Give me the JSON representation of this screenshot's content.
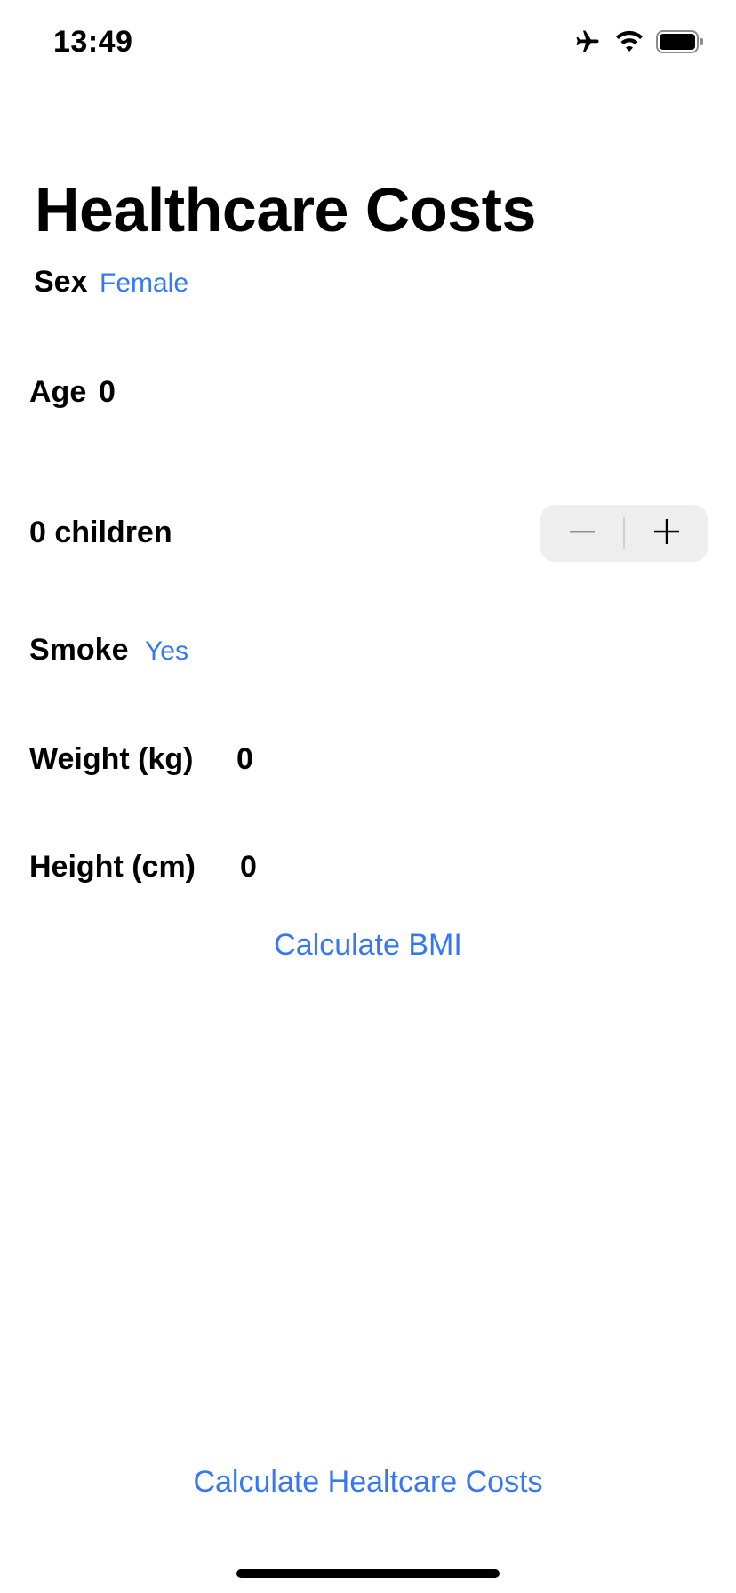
{
  "status_bar": {
    "time": "13:49",
    "icons": [
      "airplane-icon",
      "wifi-icon",
      "battery-icon"
    ]
  },
  "title": "Healthcare Costs",
  "sex": {
    "label": "Sex",
    "value": "Female"
  },
  "age": {
    "label": "Age",
    "value": "0"
  },
  "children": {
    "label": "0 children",
    "minus": "−",
    "plus": "+"
  },
  "smoke": {
    "label": "Smoke",
    "value": "Yes"
  },
  "weight": {
    "label": "Weight (kg)",
    "value": "0"
  },
  "height": {
    "label": "Height (cm)",
    "value": "0"
  },
  "actions": {
    "calculate_bmi": "Calculate BMI",
    "calculate_costs": "Calculate Healtcare Costs"
  },
  "colors": {
    "accent": "#3478F6",
    "stepper_bg": "#EEEEEF",
    "text": "#000000"
  }
}
